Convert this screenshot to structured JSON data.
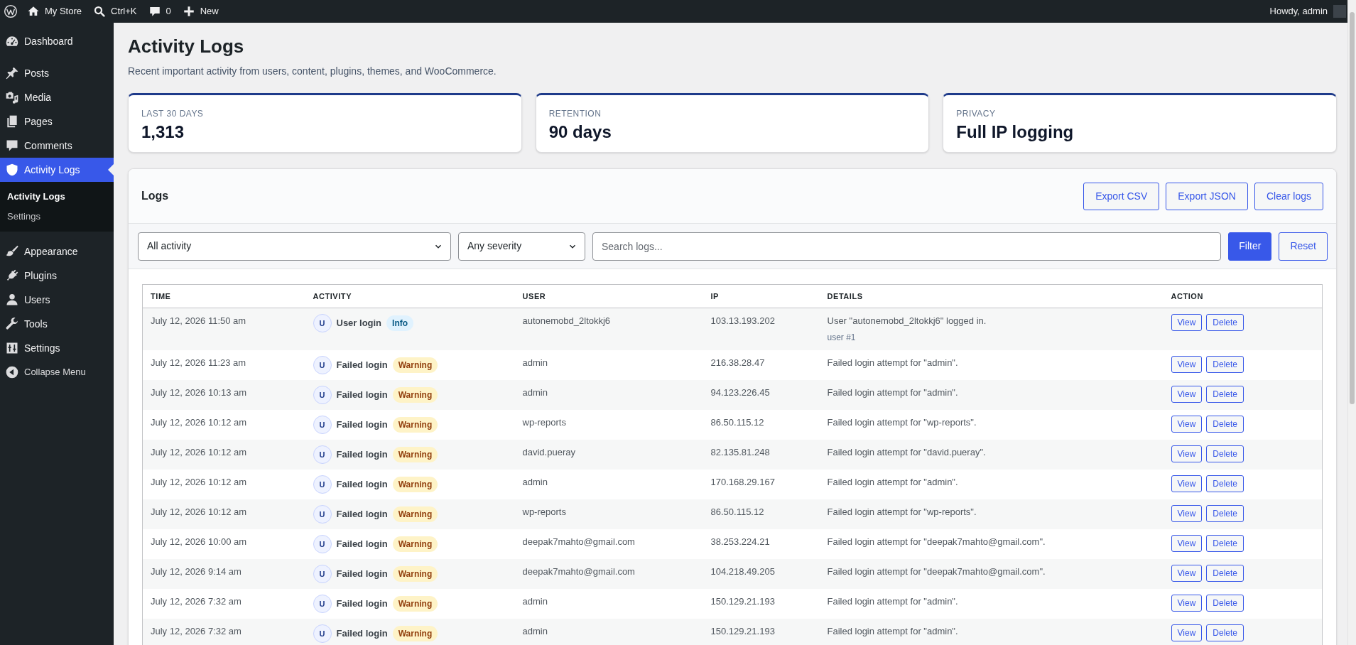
{
  "admin_bar": {
    "site_name": "My Store",
    "search_shortcut": "Ctrl+K",
    "comment_count": "0",
    "new_label": "New",
    "greeting": "Howdy, admin"
  },
  "sidebar": {
    "sections": [
      {
        "items": [
          {
            "label": "Dashboard",
            "selected": false
          }
        ]
      },
      {
        "items": [
          {
            "label": "Posts",
            "selected": false
          },
          {
            "label": "Media",
            "selected": false
          },
          {
            "label": "Pages",
            "selected": false
          },
          {
            "label": "Comments",
            "selected": false
          },
          {
            "label": "Activity Logs",
            "selected": true,
            "children": [
              {
                "label": "Activity Logs",
                "selected": true
              },
              {
                "label": "Settings",
                "selected": false
              }
            ]
          }
        ]
      },
      {
        "items": [
          {
            "label": "Appearance",
            "selected": false
          },
          {
            "label": "Plugins",
            "selected": false
          },
          {
            "label": "Users",
            "selected": false
          },
          {
            "label": "Tools",
            "selected": false
          },
          {
            "label": "Settings",
            "selected": false
          }
        ]
      }
    ],
    "collapse_label": "Collapse Menu"
  },
  "page": {
    "title": "Activity Logs",
    "subtitle": "Recent important activity from users, content, plugins, themes, and WooCommerce."
  },
  "stats": [
    {
      "label": "LAST 30 DAYS",
      "value": "1,313"
    },
    {
      "label": "RETENTION",
      "value": "90 days"
    },
    {
      "label": "PRIVACY",
      "value": "Full IP logging"
    }
  ],
  "logs_panel": {
    "title": "Logs",
    "header_buttons": [
      "Export CSV",
      "Export JSON",
      "Clear logs"
    ],
    "filters": {
      "activity": "All activity",
      "severity": "Any severity",
      "search": {
        "placeholder": "Search logs..."
      },
      "buttons": [
        {
          "label": "Filter",
          "kind": "primary"
        },
        {
          "label": "Reset",
          "kind": "secondary"
        }
      ]
    },
    "table": {
      "columns": [
        "TIME",
        "ACTIVITY",
        "USER",
        "IP",
        "DETAILS",
        "ACTION"
      ],
      "rows": [
        {
          "time": "July 12, 2026 11:50 am",
          "avatar": "U",
          "activity": "User login",
          "severity": {
            "label": "Info",
            "kind": "info"
          },
          "user": "autonemobd_2ltokkj6",
          "ip": "103.13.193.202",
          "details": "User \"autonemobd_2ltokkj6\" logged in.",
          "details_note": "user #1",
          "actions": [
            "View",
            "Delete"
          ]
        },
        {
          "time": "July 12, 2026 11:23 am",
          "avatar": "U",
          "activity": "Failed login",
          "severity": {
            "label": "Warning",
            "kind": "warning"
          },
          "user": "admin",
          "ip": "216.38.28.47",
          "details": "Failed login attempt for \"admin\".",
          "actions": [
            "View",
            "Delete"
          ]
        },
        {
          "time": "July 12, 2026 10:13 am",
          "avatar": "U",
          "activity": "Failed login",
          "severity": {
            "label": "Warning",
            "kind": "warning"
          },
          "user": "admin",
          "ip": "94.123.226.45",
          "details": "Failed login attempt for \"admin\".",
          "actions": [
            "View",
            "Delete"
          ]
        },
        {
          "time": "July 12, 2026 10:12 am",
          "avatar": "U",
          "activity": "Failed login",
          "severity": {
            "label": "Warning",
            "kind": "warning"
          },
          "user": "wp-reports",
          "ip": "86.50.115.12",
          "details": "Failed login attempt for \"wp-reports\".",
          "actions": [
            "View",
            "Delete"
          ]
        },
        {
          "time": "July 12, 2026 10:12 am",
          "avatar": "U",
          "activity": "Failed login",
          "severity": {
            "label": "Warning",
            "kind": "warning"
          },
          "user": "david.pueray",
          "ip": "82.135.81.248",
          "details": "Failed login attempt for \"david.pueray\".",
          "actions": [
            "View",
            "Delete"
          ]
        },
        {
          "time": "July 12, 2026 10:12 am",
          "avatar": "U",
          "activity": "Failed login",
          "severity": {
            "label": "Warning",
            "kind": "warning"
          },
          "user": "admin",
          "ip": "170.168.29.167",
          "details": "Failed login attempt for \"admin\".",
          "actions": [
            "View",
            "Delete"
          ]
        },
        {
          "time": "July 12, 2026 10:12 am",
          "avatar": "U",
          "activity": "Failed login",
          "severity": {
            "label": "Warning",
            "kind": "warning"
          },
          "user": "wp-reports",
          "ip": "86.50.115.12",
          "details": "Failed login attempt for \"wp-reports\".",
          "actions": [
            "View",
            "Delete"
          ]
        },
        {
          "time": "July 12, 2026 10:00 am",
          "avatar": "U",
          "activity": "Failed login",
          "severity": {
            "label": "Warning",
            "kind": "warning"
          },
          "user": "deepak7mahto@gmail.com",
          "ip": "38.253.224.21",
          "details": "Failed login attempt for \"deepak7mahto@gmail.com\".",
          "actions": [
            "View",
            "Delete"
          ]
        },
        {
          "time": "July 12, 2026 9:14 am",
          "avatar": "U",
          "activity": "Failed login",
          "severity": {
            "label": "Warning",
            "kind": "warning"
          },
          "user": "deepak7mahto@gmail.com",
          "ip": "104.218.49.205",
          "details": "Failed login attempt for \"deepak7mahto@gmail.com\".",
          "actions": [
            "View",
            "Delete"
          ]
        },
        {
          "time": "July 12, 2026 7:32 am",
          "avatar": "U",
          "activity": "Failed login",
          "severity": {
            "label": "Warning",
            "kind": "warning"
          },
          "user": "admin",
          "ip": "150.129.21.193",
          "details": "Failed login attempt for \"admin\".",
          "actions": [
            "View",
            "Delete"
          ]
        },
        {
          "time": "July 12, 2026 7:32 am",
          "avatar": "U",
          "activity": "Failed login",
          "severity": {
            "label": "Warning",
            "kind": "warning"
          },
          "user": "admin",
          "ip": "150.129.21.193",
          "details": "Failed login attempt for \"admin\".",
          "actions": [
            "View",
            "Delete"
          ]
        }
      ]
    }
  }
}
